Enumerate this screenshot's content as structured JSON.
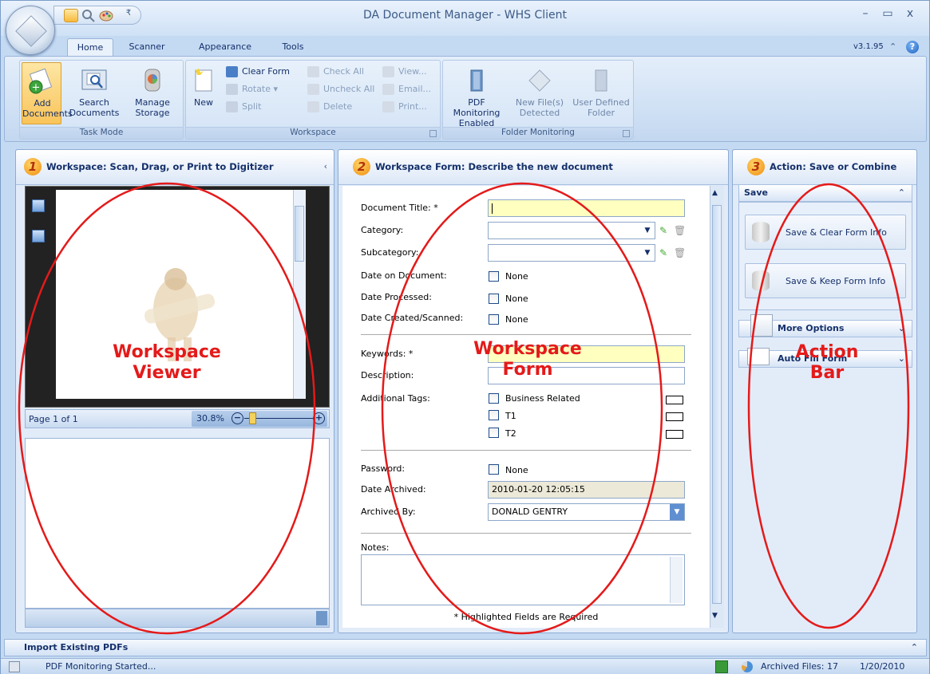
{
  "window": {
    "title": "DA Document Manager - WHS Client"
  },
  "tabs": [
    {
      "label": "Home"
    },
    {
      "label": "Scanner"
    },
    {
      "label": "Appearance"
    },
    {
      "label": "Tools"
    }
  ],
  "version": "v3.1.95",
  "ribbon": {
    "task_mode": {
      "label": "Task Mode",
      "add": "Add Documents",
      "search": "Search Documents",
      "manage": "Manage Storage"
    },
    "workspace": {
      "label": "Workspace",
      "new": "New",
      "clear_form": "Clear Form",
      "rotate": "Rotate ▾",
      "split": "Split",
      "check_all": "Check All",
      "uncheck_all": "Uncheck All",
      "delete": "Delete",
      "view": "View...",
      "email": "Email...",
      "print": "Print..."
    },
    "folder_monitoring": {
      "label": "Folder Monitoring",
      "pdf": "PDF Monitoring Enabled",
      "new_files": "New File(s) Detected",
      "user_folder": "User Defined Folder"
    }
  },
  "panels": {
    "viewer": {
      "number": "1",
      "title": "Workspace:  Scan, Drag, or Print to Digitizer",
      "page": "Page 1 of 1",
      "zoom": "30.8%"
    },
    "form": {
      "number": "2",
      "title": "Workspace Form:  Describe the new document"
    },
    "action": {
      "number": "3",
      "title": "Action:  Save or Combine"
    }
  },
  "form": {
    "document_title": "Document Title: *",
    "category": "Category:",
    "subcategory": "Subcategory:",
    "date_on_document": "Date on Document:",
    "date_processed": "Date Processed:",
    "date_created": "Date Created/Scanned:",
    "none": "None",
    "keywords": "Keywords: *",
    "description": "Description:",
    "additional_tags": "Additional Tags:",
    "tags": [
      "Business Related",
      "T1",
      "T2"
    ],
    "password": "Password:",
    "date_archived": "Date Archived:",
    "date_archived_value": "2010-01-20 12:05:15",
    "archived_by": "Archived By:",
    "archived_by_value": "DONALD GENTRY",
    "notes": "Notes:",
    "footnote": "* Highlighted Fields are Required"
  },
  "action": {
    "save_section": "Save",
    "save_clear": "Save & Clear Form Info",
    "save_keep": "Save & Keep Form Info",
    "more_options": "More Options",
    "auto_fill": "Auto Fill Form"
  },
  "annotations": {
    "viewer": [
      "Workspace",
      "Viewer"
    ],
    "form": [
      "Workspace",
      "Form"
    ],
    "action": [
      "Action",
      "Bar"
    ]
  },
  "import_bar": "Import Existing PDFs",
  "status": {
    "message": "PDF Monitoring Started...",
    "archived": "Archived Files: 17",
    "date": "1/20/2010"
  },
  "colors": {
    "annotation": "#e41a1a",
    "accent": "#15306a",
    "required_field": "#ffffc0"
  }
}
